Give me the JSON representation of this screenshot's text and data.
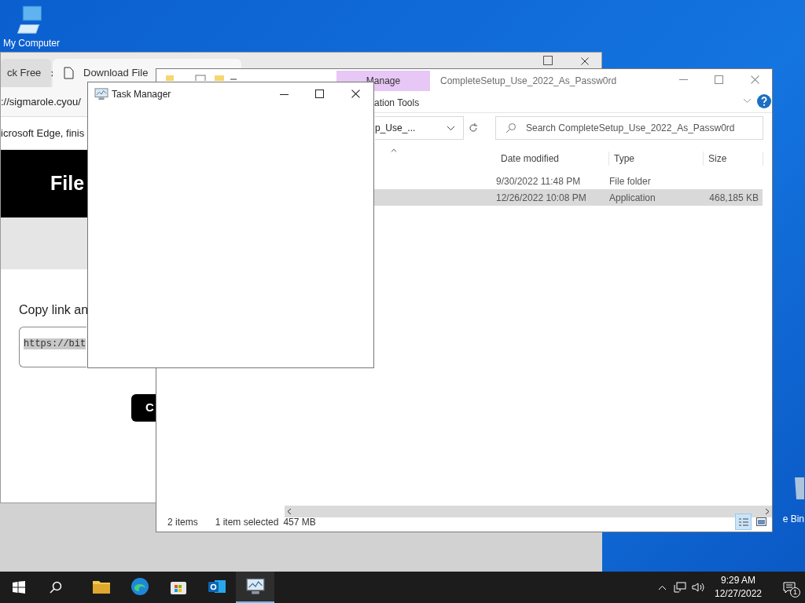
{
  "desktop_icons": [
    {
      "kind": "computer",
      "label": "My Computer"
    },
    {
      "kind": "bin",
      "label": "e Bin"
    }
  ],
  "browser": {
    "tabs": [
      {
        "label": "ck Free",
        "selected": false
      },
      {
        "label": "Download File",
        "selected": true
      }
    ],
    "address": "://sigmarole.cyou/",
    "info_bar": "icrosoft Edge, finis",
    "banner": "File",
    "prompt": "Copy link an",
    "link_field": "https://bit",
    "button": "C"
  },
  "task_manager": {
    "title": "Task Manager"
  },
  "explorer": {
    "ribbon_tab": "Manage",
    "ribbon_group": "ation Tools",
    "title": "CompleteSetup_Use_2022_As_Passw0rd",
    "address": "p_Use_...",
    "search": {
      "placeholder": "Search CompleteSetup_Use_2022_As_Passw0rd"
    },
    "columns": [
      "Date modified",
      "Type",
      "Size"
    ],
    "rows": [
      {
        "date": "9/30/2022 11:48 PM",
        "type": "File folder",
        "size": "",
        "selected": false
      },
      {
        "date": "12/26/2022 10:08 PM",
        "type": "Application",
        "size": "468,185 KB",
        "selected": true
      }
    ],
    "status": {
      "items": "2 items",
      "selection": "1 item selected",
      "size": "457 MB"
    }
  },
  "taskbar": {
    "apps": [
      {
        "kind": "explorer",
        "active": false
      },
      {
        "kind": "edge",
        "active": false
      },
      {
        "kind": "store",
        "active": false
      },
      {
        "kind": "outlook",
        "active": false
      },
      {
        "kind": "taskmgr",
        "active": true
      }
    ],
    "time": "9:29 AM",
    "date": "12/27/2022",
    "notifications": "1"
  }
}
